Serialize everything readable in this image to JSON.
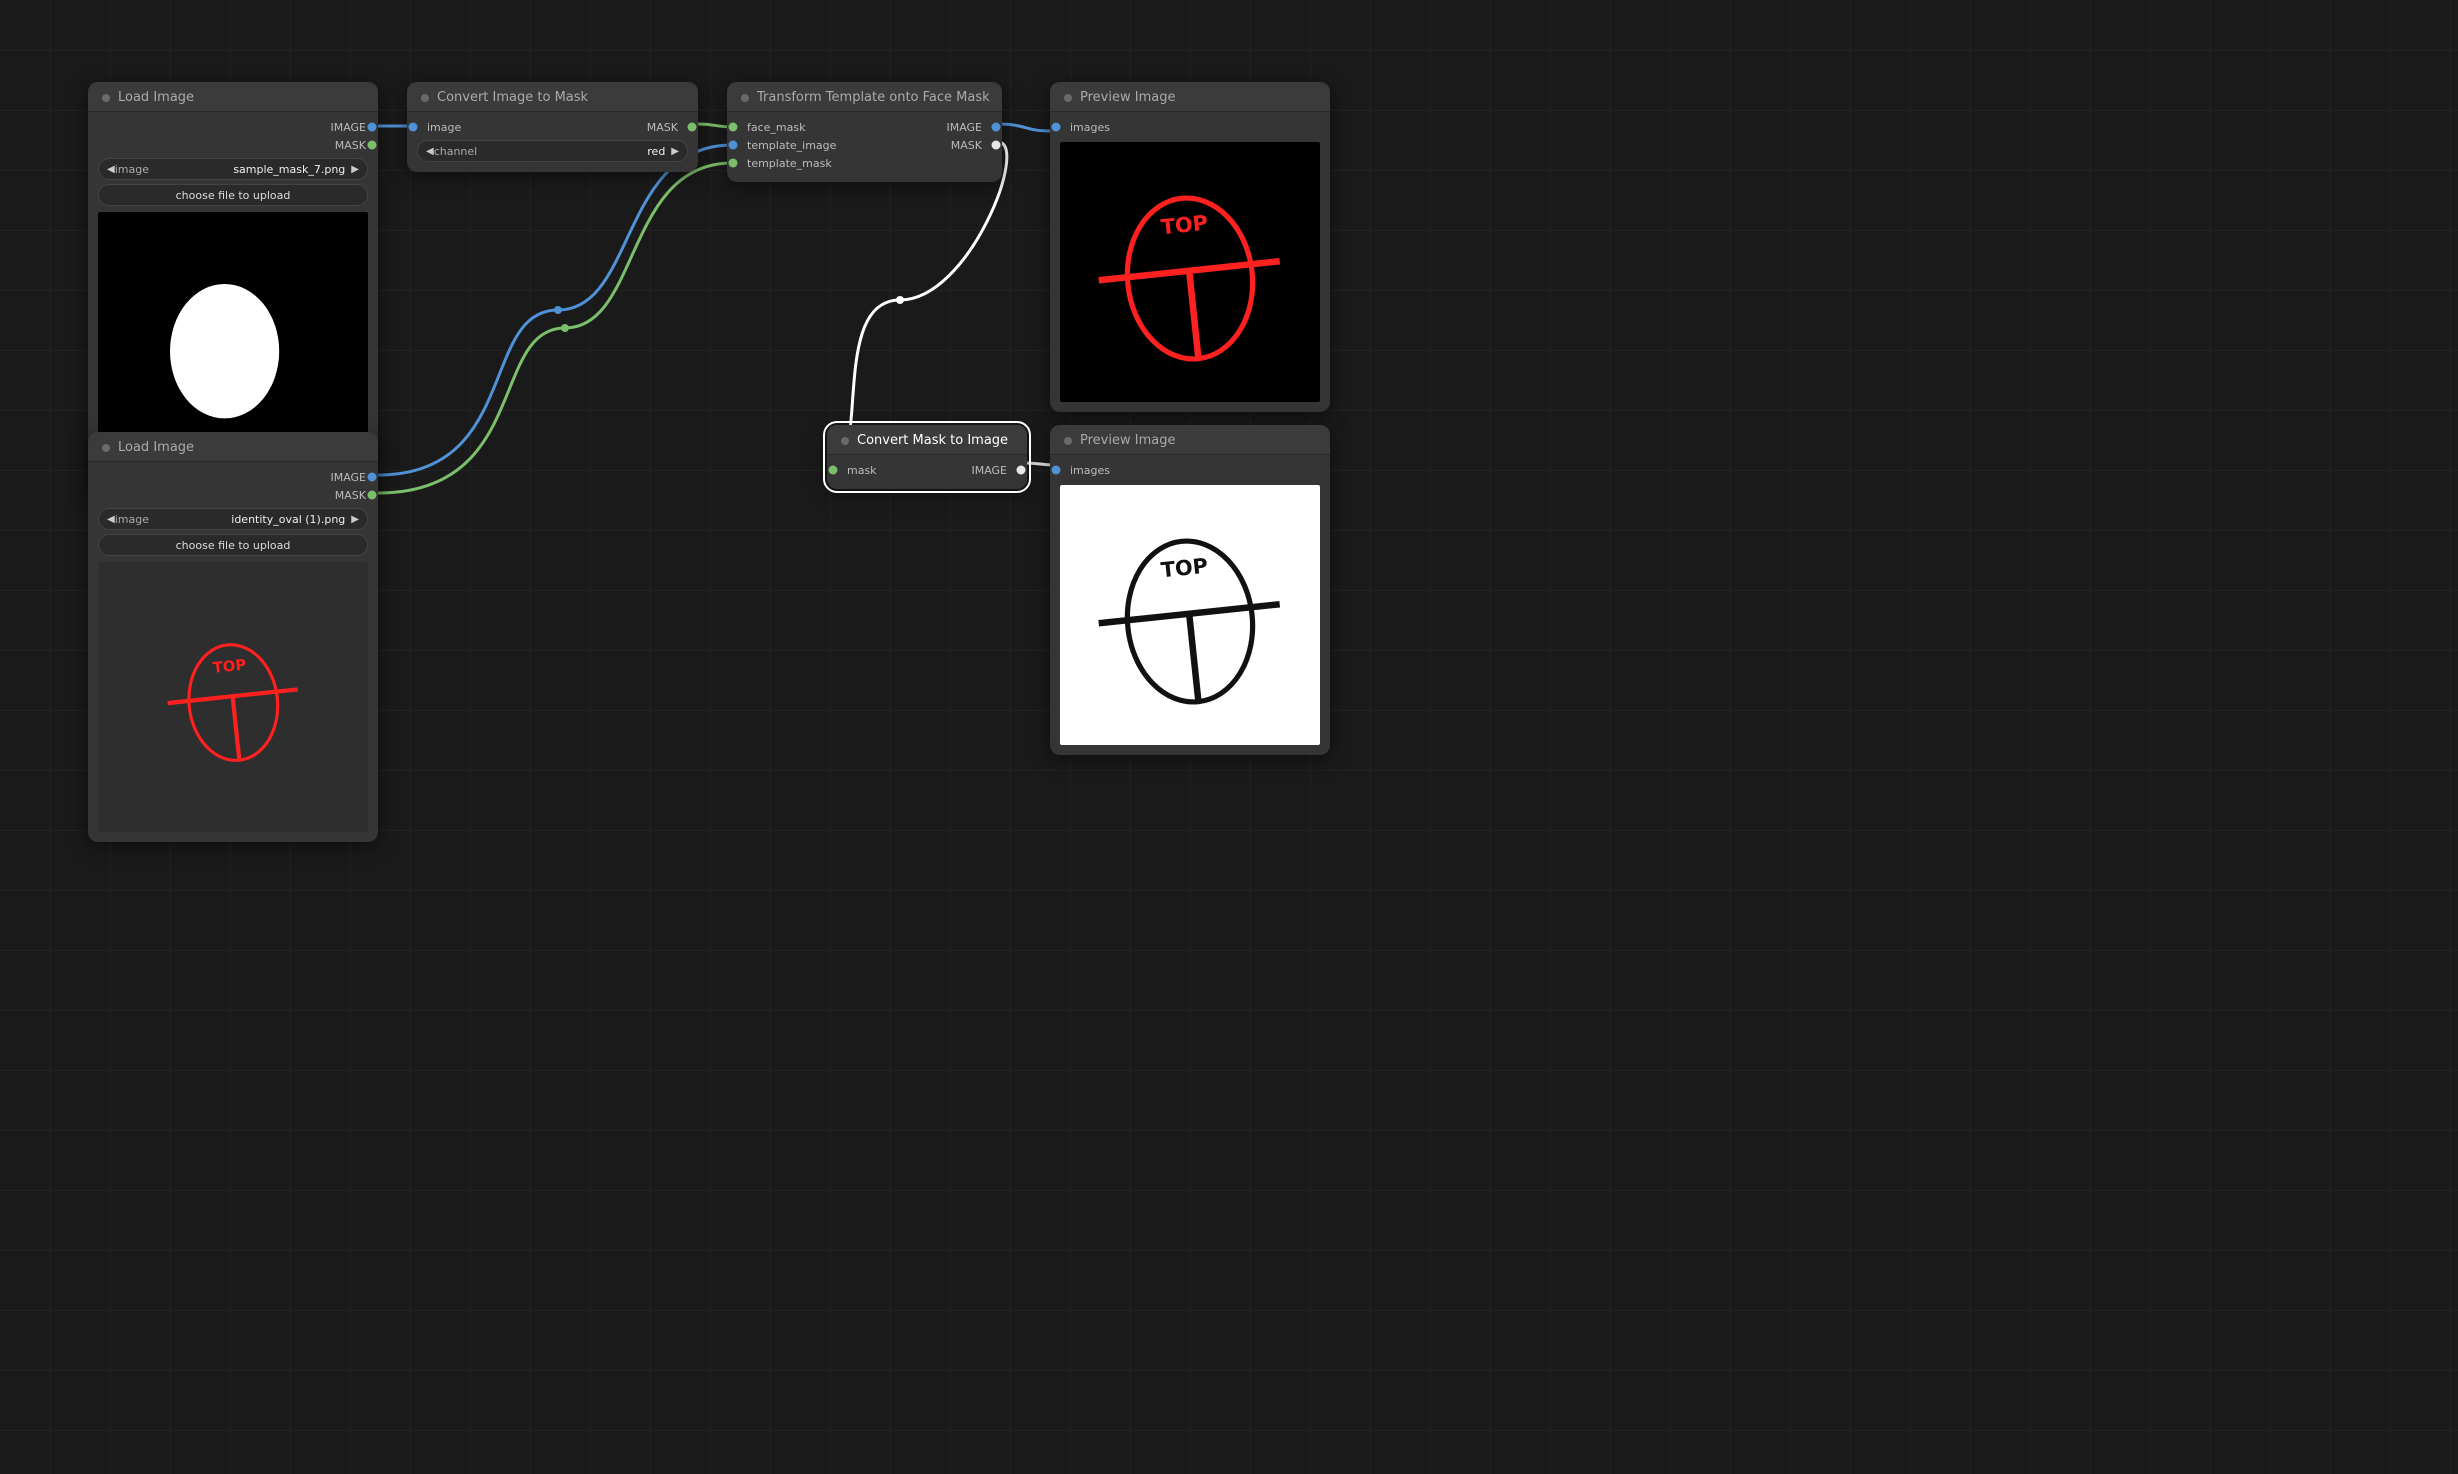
{
  "labels": {
    "image_out": "IMAGE",
    "mask_out": "MASK",
    "choose_file": "choose file to upload",
    "image_widget_label": "image",
    "channel_label": "channel"
  },
  "nodes": {
    "load1": {
      "title": "Load Image",
      "image_file": "sample_mask_7.png"
    },
    "load2": {
      "title": "Load Image",
      "image_file": "identity_oval (1).png"
    },
    "convert_i2m": {
      "title": "Convert Image to Mask",
      "input_image": "image",
      "channel_value": "red"
    },
    "transform": {
      "title": "Transform Template onto Face Mask",
      "in_face_mask": "face_mask",
      "in_template_image": "template_image",
      "in_template_mask": "template_mask"
    },
    "convert_m2i": {
      "title": "Convert Mask to Image",
      "in_mask": "mask"
    },
    "preview1": {
      "title": "Preview Image",
      "in_images": "images"
    },
    "preview2": {
      "title": "Preview Image",
      "in_images": "images"
    }
  },
  "overlay_text": "TOP",
  "colors": {
    "wire_image": "#4f92d6",
    "wire_mask": "#7bbf6a",
    "wire_white": "#ffffff",
    "overlay_red": "#ff2020"
  },
  "chart_data": null
}
